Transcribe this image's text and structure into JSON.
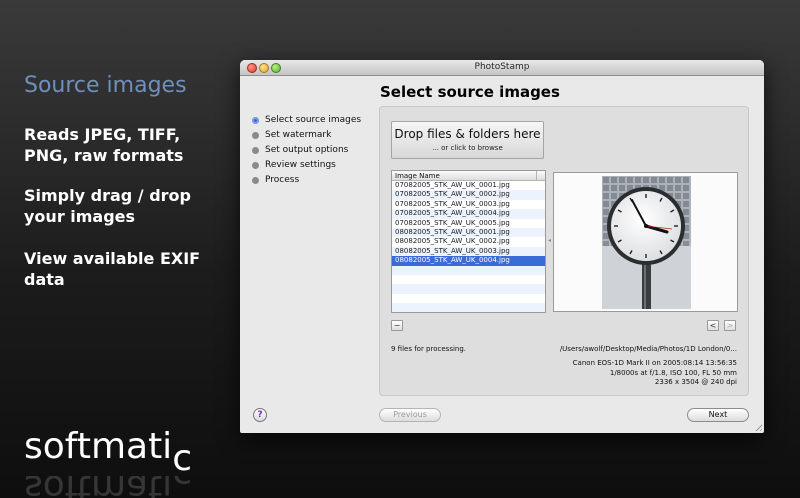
{
  "promo": {
    "heading": "Source images",
    "features": [
      "Reads JPEG, TIFF, PNG, raw formats",
      "Simply drag / drop your images",
      "View available EXIF data"
    ]
  },
  "brand": {
    "main": "softmati",
    "sub": "c"
  },
  "window": {
    "title": "PhotoStamp",
    "heading": "Select source images",
    "steps": [
      {
        "label": "Select source images",
        "active": true
      },
      {
        "label": "Set watermark",
        "active": false
      },
      {
        "label": "Set output options",
        "active": false
      },
      {
        "label": "Review settings",
        "active": false
      },
      {
        "label": "Process",
        "active": false
      }
    ],
    "drop_zone": {
      "title": "Drop files & folders here",
      "subtitle": "... or click to browse"
    },
    "file_list": {
      "column_header": "Image Name",
      "files": [
        "07082005_STK_AW_UK_0001.jpg",
        "07082005_STK_AW_UK_0002.jpg",
        "07082005_STK_AW_UK_0003.jpg",
        "07082005_STK_AW_UK_0004.jpg",
        "07082005_STK_AW_UK_0005.jpg",
        "08082005_STK_AW_UK_0001.jpg",
        "08082005_STK_AW_UK_0002.jpg",
        "08082005_STK_AW_UK_0003.jpg",
        "08082005_STK_AW_UK_0004.jpg"
      ],
      "selected_index": 8
    },
    "remove_button": "−",
    "prev_button": "<",
    "next_image_button": ">",
    "status": "9 files for processing.",
    "path": "/Users/awolf/Desktop/Media/Photos/1D London/0...",
    "exif": [
      "Canon EOS-1D Mark II on 2005:08:14 13:56:35",
      "1/8000s at f/1.8, ISO 100, FL 50 mm",
      "2336 x 3504 @ 240 dpi"
    ],
    "help_button": "?",
    "previous_button": "Previous",
    "next_button": "Next"
  },
  "colors": {
    "promo_heading": "#6f8fbd",
    "selection": "#3b6bd5",
    "active_step": "#3b63c9"
  }
}
